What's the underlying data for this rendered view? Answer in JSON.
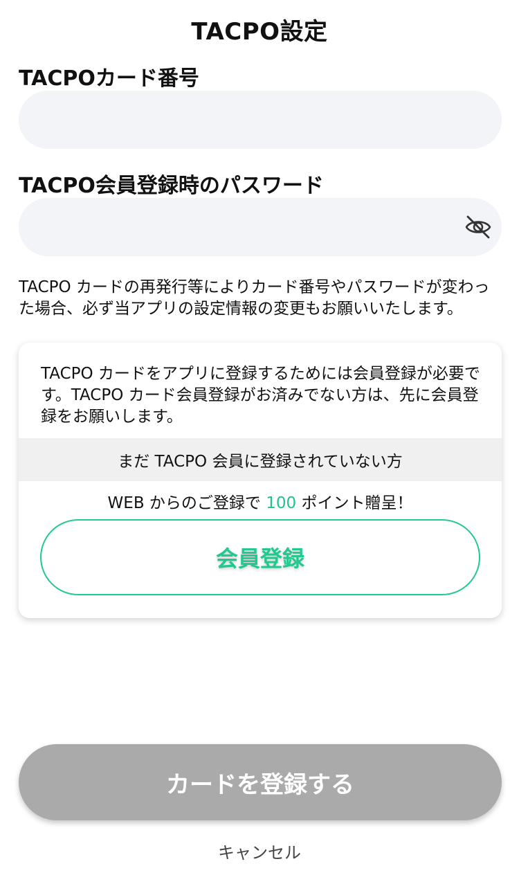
{
  "page": {
    "title": "TACPO設定"
  },
  "form": {
    "card_number_label": "TACPOカード番号",
    "card_number_value": "",
    "password_label": "TACPO会員登録時のパスワード",
    "password_value": "",
    "password_visibility_icon": "eye-off-icon"
  },
  "notice": {
    "text": "TACPO カードの再発行等によりカード番号やパスワードが変わった場合、必ず当アプリの設定情報の変更もお願いいたします。"
  },
  "info_card": {
    "text": "TACPO カードをアプリに登録するためには会員登録が必要です。TACPO カード会員登録がお済みでない方は、先に会員登録をお願いします。",
    "not_member_label": "まだ TACPO 会員に登録されていない方",
    "bonus_prefix": "WEB からのご登録で ",
    "bonus_points": "100",
    "bonus_suffix": " ポイント贈呈！",
    "member_button_label": "会員登録"
  },
  "actions": {
    "register_label": "カードを登録する",
    "cancel_label": "キャンセル"
  },
  "colors": {
    "accent": "#22c98e",
    "input_bg": "#f3f4f8",
    "disabled_button": "#aaaaaa"
  }
}
